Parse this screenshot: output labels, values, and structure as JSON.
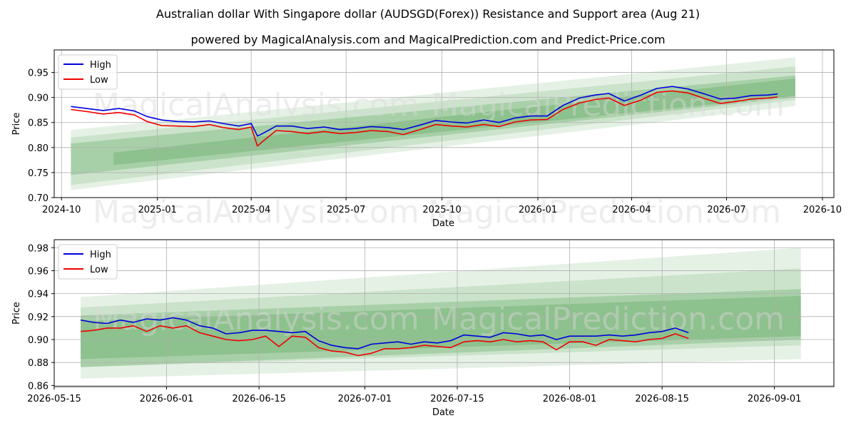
{
  "title": "Australian dollar With Singapore dollar (AUDSGD(Forex)) Resistance and Support area (Aug 21)",
  "subtitle": "powered by MagicalAnalysis.com and MagicalPrediction.com and Predict-Price.com",
  "watermarks": [
    "MagicalAnalysis.com",
    "MagicalPrediction.com"
  ],
  "colors": {
    "high": "#0000dd",
    "low": "#ee0000",
    "band": "#2e8b2e",
    "grid": "#b0b0b0"
  },
  "chart_data": [
    {
      "type": "line",
      "xlabel": "Date",
      "ylabel": "Price",
      "ylim": [
        0.7,
        0.995
      ],
      "xlim": [
        "2024-09-24",
        "2026-10-12"
      ],
      "grid": true,
      "legend": "top-left",
      "x_ticks": [
        "2024-10",
        "2025-01",
        "2025-04",
        "2025-07",
        "2025-10",
        "2026-01",
        "2026-04",
        "2026-07",
        "2026-10"
      ],
      "y_ticks": [
        "0.70",
        "0.75",
        "0.80",
        "0.85",
        "0.90",
        "0.95"
      ],
      "series": [
        {
          "name": "High",
          "x": [
            "2024-10-10",
            "2024-10-25",
            "2024-11-10",
            "2024-11-25",
            "2024-12-10",
            "2024-12-22",
            "2025-01-05",
            "2025-01-20",
            "2025-02-05",
            "2025-02-20",
            "2025-03-05",
            "2025-03-20",
            "2025-04-01",
            "2025-04-07",
            "2025-04-12",
            "2025-04-25",
            "2025-05-10",
            "2025-05-25",
            "2025-06-10",
            "2025-06-25",
            "2025-07-10",
            "2025-07-25",
            "2025-08-10",
            "2025-08-25",
            "2025-09-10",
            "2025-09-25",
            "2025-10-10",
            "2025-10-25",
            "2025-11-10",
            "2025-11-25",
            "2025-12-10",
            "2025-12-25",
            "2026-01-10",
            "2026-01-25",
            "2026-02-10",
            "2026-02-25",
            "2026-03-10",
            "2026-03-25",
            "2026-04-10",
            "2026-04-25",
            "2026-05-10",
            "2026-05-25",
            "2026-06-10",
            "2026-06-25",
            "2026-07-10",
            "2026-07-25",
            "2026-08-10",
            "2026-08-19"
          ],
          "values": [
            0.882,
            0.878,
            0.874,
            0.878,
            0.873,
            0.862,
            0.855,
            0.852,
            0.851,
            0.853,
            0.848,
            0.843,
            0.848,
            0.823,
            0.828,
            0.843,
            0.843,
            0.838,
            0.841,
            0.836,
            0.838,
            0.842,
            0.84,
            0.836,
            0.845,
            0.854,
            0.851,
            0.849,
            0.855,
            0.85,
            0.859,
            0.863,
            0.863,
            0.884,
            0.899,
            0.905,
            0.908,
            0.893,
            0.905,
            0.918,
            0.922,
            0.917,
            0.907,
            0.897,
            0.899,
            0.904,
            0.905,
            0.907
          ]
        },
        {
          "name": "Low",
          "x": [
            "2024-10-10",
            "2024-10-25",
            "2024-11-10",
            "2024-11-25",
            "2024-12-10",
            "2024-12-22",
            "2025-01-05",
            "2025-01-20",
            "2025-02-05",
            "2025-02-20",
            "2025-03-05",
            "2025-03-20",
            "2025-04-01",
            "2025-04-07",
            "2025-04-12",
            "2025-04-25",
            "2025-05-10",
            "2025-05-25",
            "2025-06-10",
            "2025-06-25",
            "2025-07-10",
            "2025-07-25",
            "2025-08-10",
            "2025-08-25",
            "2025-09-10",
            "2025-09-25",
            "2025-10-10",
            "2025-10-25",
            "2025-11-10",
            "2025-11-25",
            "2025-12-10",
            "2025-12-25",
            "2026-01-10",
            "2026-01-25",
            "2026-02-10",
            "2026-02-25",
            "2026-03-10",
            "2026-03-25",
            "2026-04-10",
            "2026-04-25",
            "2026-05-10",
            "2026-05-25",
            "2026-06-10",
            "2026-06-25",
            "2026-07-10",
            "2026-07-25",
            "2026-08-10",
            "2026-08-19"
          ],
          "values": [
            0.876,
            0.872,
            0.867,
            0.87,
            0.865,
            0.852,
            0.844,
            0.843,
            0.842,
            0.846,
            0.84,
            0.836,
            0.841,
            0.803,
            0.812,
            0.834,
            0.832,
            0.828,
            0.832,
            0.828,
            0.83,
            0.834,
            0.832,
            0.826,
            0.836,
            0.846,
            0.843,
            0.841,
            0.846,
            0.842,
            0.851,
            0.855,
            0.856,
            0.876,
            0.889,
            0.896,
            0.899,
            0.884,
            0.895,
            0.91,
            0.913,
            0.909,
            0.898,
            0.888,
            0.892,
            0.897,
            0.899,
            0.901
          ]
        }
      ],
      "bands": [
        {
          "x": [
            "2024-10-10",
            "2026-09-05"
          ],
          "lower": [
            0.715,
            0.883
          ],
          "upper": [
            0.835,
            0.98
          ],
          "opacity": 0.12
        },
        {
          "x": [
            "2024-10-10",
            "2026-09-05"
          ],
          "lower": [
            0.725,
            0.895
          ],
          "upper": [
            0.82,
            0.962
          ],
          "opacity": 0.14
        },
        {
          "x": [
            "2024-10-10",
            "2026-09-05"
          ],
          "lower": [
            0.745,
            0.9
          ],
          "upper": [
            0.808,
            0.944
          ],
          "opacity": 0.22
        },
        {
          "x": [
            "2024-11-20",
            "2026-09-05"
          ],
          "lower": [
            0.765,
            0.903
          ],
          "upper": [
            0.79,
            0.938
          ],
          "opacity": 0.22
        }
      ]
    },
    {
      "type": "line",
      "xlabel": "Date",
      "ylabel": "Price",
      "ylim": [
        0.859,
        0.987
      ],
      "xlim": [
        "2026-05-15",
        "2026-09-10"
      ],
      "grid": true,
      "legend": "top-left",
      "x_ticks": [
        "2026-05-15",
        "2026-06-01",
        "2026-06-15",
        "2026-07-01",
        "2026-07-15",
        "2026-08-01",
        "2026-08-15",
        "2026-09-01"
      ],
      "y_ticks": [
        "0.86",
        "0.88",
        "0.90",
        "0.92",
        "0.94",
        "0.96",
        "0.98"
      ],
      "series": [
        {
          "name": "High",
          "x": [
            "2026-05-19",
            "2026-05-21",
            "2026-05-23",
            "2026-05-25",
            "2026-05-27",
            "2026-05-29",
            "2026-05-31",
            "2026-06-02",
            "2026-06-04",
            "2026-06-06",
            "2026-06-08",
            "2026-06-10",
            "2026-06-12",
            "2026-06-14",
            "2026-06-16",
            "2026-06-18",
            "2026-06-20",
            "2026-06-22",
            "2026-06-24",
            "2026-06-26",
            "2026-06-28",
            "2026-06-30",
            "2026-07-02",
            "2026-07-04",
            "2026-07-06",
            "2026-07-08",
            "2026-07-10",
            "2026-07-12",
            "2026-07-14",
            "2026-07-16",
            "2026-07-18",
            "2026-07-20",
            "2026-07-22",
            "2026-07-24",
            "2026-07-26",
            "2026-07-28",
            "2026-07-30",
            "2026-08-01",
            "2026-08-03",
            "2026-08-05",
            "2026-08-07",
            "2026-08-09",
            "2026-08-11",
            "2026-08-13",
            "2026-08-15",
            "2026-08-17",
            "2026-08-19"
          ],
          "values": [
            0.917,
            0.915,
            0.914,
            0.917,
            0.915,
            0.918,
            0.917,
            0.919,
            0.917,
            0.912,
            0.91,
            0.905,
            0.906,
            0.908,
            0.908,
            0.907,
            0.906,
            0.907,
            0.899,
            0.895,
            0.893,
            0.892,
            0.896,
            0.897,
            0.898,
            0.896,
            0.898,
            0.897,
            0.899,
            0.904,
            0.903,
            0.902,
            0.906,
            0.905,
            0.903,
            0.904,
            0.9,
            0.903,
            0.903,
            0.903,
            0.904,
            0.903,
            0.904,
            0.906,
            0.907,
            0.91,
            0.906
          ]
        },
        {
          "name": "Low",
          "x": [
            "2026-05-19",
            "2026-05-21",
            "2026-05-23",
            "2026-05-25",
            "2026-05-27",
            "2026-05-29",
            "2026-05-31",
            "2026-06-02",
            "2026-06-04",
            "2026-06-06",
            "2026-06-08",
            "2026-06-10",
            "2026-06-12",
            "2026-06-14",
            "2026-06-16",
            "2026-06-18",
            "2026-06-20",
            "2026-06-22",
            "2026-06-24",
            "2026-06-26",
            "2026-06-28",
            "2026-06-30",
            "2026-07-02",
            "2026-07-04",
            "2026-07-06",
            "2026-07-08",
            "2026-07-10",
            "2026-07-12",
            "2026-07-14",
            "2026-07-16",
            "2026-07-18",
            "2026-07-20",
            "2026-07-22",
            "2026-07-24",
            "2026-07-26",
            "2026-07-28",
            "2026-07-30",
            "2026-08-01",
            "2026-08-03",
            "2026-08-05",
            "2026-08-07",
            "2026-08-09",
            "2026-08-11",
            "2026-08-13",
            "2026-08-15",
            "2026-08-17",
            "2026-08-19"
          ],
          "values": [
            0.907,
            0.908,
            0.91,
            0.91,
            0.912,
            0.907,
            0.912,
            0.91,
            0.912,
            0.906,
            0.903,
            0.9,
            0.899,
            0.9,
            0.903,
            0.894,
            0.903,
            0.902,
            0.893,
            0.89,
            0.889,
            0.886,
            0.888,
            0.892,
            0.892,
            0.893,
            0.895,
            0.894,
            0.893,
            0.898,
            0.899,
            0.898,
            0.9,
            0.898,
            0.899,
            0.898,
            0.891,
            0.898,
            0.898,
            0.895,
            0.9,
            0.899,
            0.898,
            0.9,
            0.901,
            0.905,
            0.901
          ]
        }
      ],
      "bands": [
        {
          "x": [
            "2026-05-19",
            "2026-09-05"
          ],
          "lower": [
            0.866,
            0.883
          ],
          "upper": [
            0.937,
            0.98
          ],
          "opacity": 0.12
        },
        {
          "x": [
            "2026-05-19",
            "2026-09-05"
          ],
          "lower": [
            0.876,
            0.895
          ],
          "upper": [
            0.928,
            0.962
          ],
          "opacity": 0.14
        },
        {
          "x": [
            "2026-05-19",
            "2026-09-05"
          ],
          "lower": [
            0.876,
            0.9
          ],
          "upper": [
            0.921,
            0.944
          ],
          "opacity": 0.22
        },
        {
          "x": [
            "2026-05-19",
            "2026-09-05"
          ],
          "lower": [
            0.883,
            0.903
          ],
          "upper": [
            0.916,
            0.938
          ],
          "opacity": 0.22
        }
      ]
    }
  ]
}
